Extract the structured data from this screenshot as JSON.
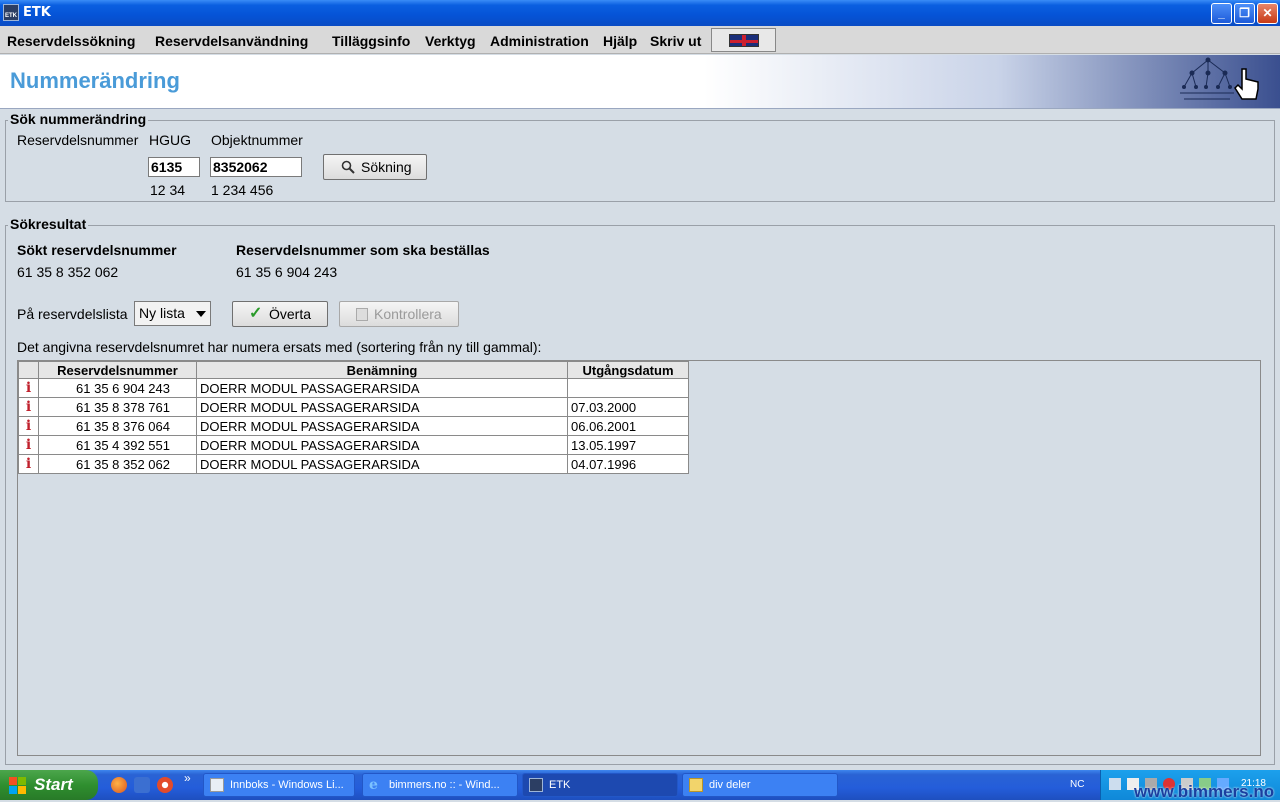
{
  "window": {
    "app_icon_text": "ETK",
    "title": "ETK"
  },
  "menu": {
    "items": [
      "Reservdelssökning",
      "Reservdelsanvändning",
      "Tilläggsinfo",
      "Verktyg",
      "Administration",
      "Hjälp",
      "Skriv ut"
    ],
    "language_flag_icon": "uk-flag-icon"
  },
  "header": {
    "title": "Nummerändring"
  },
  "search": {
    "group_title": "Sök nummerändring",
    "label_part_number": "Reservdelsnummer",
    "label_hgug": "HGUG",
    "label_object_number": "Objektnummer",
    "hgug_value": "6135",
    "object_value": "8352062",
    "hgug_hint": "12 34",
    "object_hint": "1 234 456",
    "search_button": "Sökning"
  },
  "results": {
    "group_title": "Sökresultat",
    "searched_label": "Sökt reservdelsnummer",
    "searched_value": "61 35 8 352 062",
    "order_label": "Reservdelsnummer som ska beställas",
    "order_value": "61 35 6 904 243",
    "list_label": "På reservdelslista",
    "list_select_value": "Ny lista",
    "adopt_button": "Överta",
    "check_button": "Kontrollera",
    "description": "Det angivna reservdelsnumret har numera ersats med (sortering från ny till gammal):",
    "table": {
      "headers": [
        "Reservdelsnummer",
        "Benämning",
        "Utgångsdatum"
      ],
      "rows": [
        {
          "info": "i",
          "number": "61 35 6 904 243",
          "name": "DOERR MODUL PASSAGERARSIDA",
          "date": ""
        },
        {
          "info": "i",
          "number": "61 35 8 378 761",
          "name": "DOERR MODUL PASSAGERARSIDA",
          "date": "07.03.2000"
        },
        {
          "info": "i",
          "number": "61 35 8 376 064",
          "name": "DOERR MODUL PASSAGERARSIDA",
          "date": "06.06.2001"
        },
        {
          "info": "i",
          "number": "61 35 4 392 551",
          "name": "DOERR MODUL PASSAGERARSIDA",
          "date": "13.05.1997"
        },
        {
          "info": "i",
          "number": "61 35 8 352 062",
          "name": "DOERR MODUL PASSAGERARSIDA",
          "date": "04.07.1996"
        }
      ]
    }
  },
  "taskbar": {
    "start_label": "Start",
    "quicklaunch_more": "»",
    "tasks": [
      {
        "label": "Innboks - Windows Li...",
        "icon": "mail-icon"
      },
      {
        "label": "bimmers.no :: - Wind...",
        "icon": "ie-icon"
      },
      {
        "label": "ETK",
        "icon": "etk-icon",
        "active": true
      },
      {
        "label": "div deler",
        "icon": "folder-icon"
      }
    ],
    "language": "NC",
    "clock": "21:18"
  },
  "watermark": "www.bimmers.no"
}
